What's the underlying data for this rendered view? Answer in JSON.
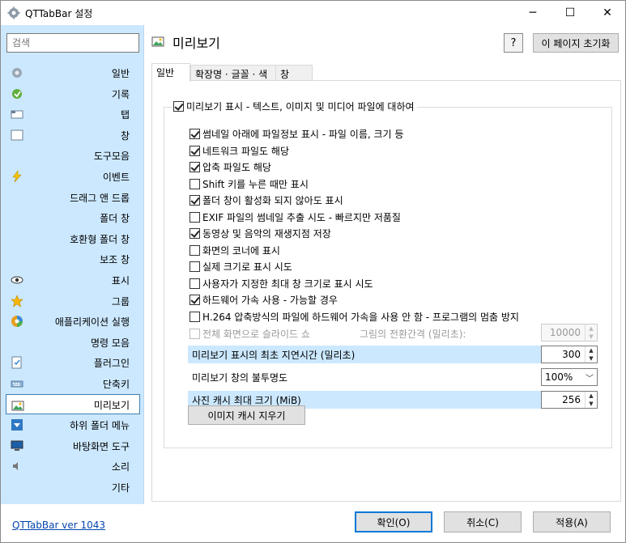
{
  "window": {
    "title": "QTTabBar 설정",
    "controls": {
      "minimize": "─",
      "maximize": "☐",
      "close": "✕"
    }
  },
  "sidebar": {
    "search_placeholder": "검색",
    "items": [
      {
        "label": "일반",
        "icon": "gear-icon"
      },
      {
        "label": "기록",
        "icon": "history-icon"
      },
      {
        "label": "탭",
        "icon": "tab-icon"
      },
      {
        "label": "창",
        "icon": "window-icon"
      },
      {
        "label": "도구모음",
        "icon": ""
      },
      {
        "label": "이벤트",
        "icon": "lightning-icon"
      },
      {
        "label": "드래그 앤 드롭",
        "icon": ""
      },
      {
        "label": "폴더 창",
        "icon": ""
      },
      {
        "label": "호환형 폴더 창",
        "icon": ""
      },
      {
        "label": "보조 창",
        "icon": ""
      },
      {
        "label": "표시",
        "icon": "eye-icon"
      },
      {
        "label": "그룹",
        "icon": "star-icon"
      },
      {
        "label": "애플리케이션 실행",
        "icon": "app-launch-icon"
      },
      {
        "label": "명령 모음",
        "icon": ""
      },
      {
        "label": "플러그인",
        "icon": "plugin-icon"
      },
      {
        "label": "단축키",
        "icon": "keyboard-icon"
      },
      {
        "label": "미리보기",
        "icon": "preview-icon",
        "active": true
      },
      {
        "label": "하위 폴더 메뉴",
        "icon": "subfolder-menu-icon"
      },
      {
        "label": "바탕화면 도구",
        "icon": "desktop-icon"
      },
      {
        "label": "소리",
        "icon": "speaker-icon"
      },
      {
        "label": "기타",
        "icon": ""
      }
    ],
    "version_link": "QTTabBar ver 1043"
  },
  "header": {
    "title": "미리보기",
    "help_label": "?",
    "reset_label": "이 페이지 초기화"
  },
  "tabs": [
    {
      "label": "일반",
      "active": true
    },
    {
      "label": "확장명 · 글꼴 · 색",
      "active": false
    },
    {
      "label": "창",
      "active": false
    }
  ],
  "preview": {
    "master": {
      "label": "미리보기 표시 - 텍스트, 이미지 및 미디어 파일에 대하여",
      "checked": true
    },
    "options": [
      {
        "label": "썸네일 아래에 파일정보 표시 - 파일 이름, 크기 등",
        "checked": true
      },
      {
        "label": "네트워크 파일도 해당",
        "checked": true
      },
      {
        "label": "압축 파일도 해당",
        "checked": true
      },
      {
        "label": "Shift 키를 누른 때만 표시",
        "checked": false
      },
      {
        "label": "폴더 창이 활성화 되지 않아도 표시",
        "checked": true
      },
      {
        "label": "EXIF 파일의 썸네일 추출 시도 - 빠르지만 저품질",
        "checked": false
      },
      {
        "label": "동영상 및 음악의 재생지점 저장",
        "checked": true
      },
      {
        "label": "화면의 코너에 표시",
        "checked": false
      },
      {
        "label": "실제 크기로 표시 시도",
        "checked": false
      },
      {
        "label": "사용자가 지정한 최대 창 크기로 표시 시도",
        "checked": false
      },
      {
        "label": "하드웨어 가속 사용 - 가능할 경우",
        "checked": true
      },
      {
        "label": "H.264 압축방식의 파일에 하드웨어 가속을 사용 안 함 - 프로그램의 멈춤 방지",
        "checked": false
      }
    ],
    "slideshow": {
      "label": "전체 화면으로 슬라이드 쇼",
      "interval_label": "그림의 전환간격 (밀리초):",
      "interval_value": "10000",
      "checked": false
    },
    "delay": {
      "label": "미리보기 표시의 최초 지연시간 (밀리초)",
      "value": "300"
    },
    "opacity": {
      "label": "미리보기 창의 불투명도",
      "value": "100%"
    },
    "cache": {
      "label": "사진 캐시 최대 크기 (MiB)",
      "value": "256"
    },
    "clear_cache_label": "이미지 캐시 지우기"
  },
  "footer": {
    "ok_label": "확인(O)",
    "cancel_label": "취소(C)",
    "apply_label": "적용(A)"
  },
  "colors": {
    "sidebar_bg": "#cce8ff",
    "highlight_row": "#cce8ff",
    "link": "#0645ad",
    "accent": "#0078d7"
  }
}
